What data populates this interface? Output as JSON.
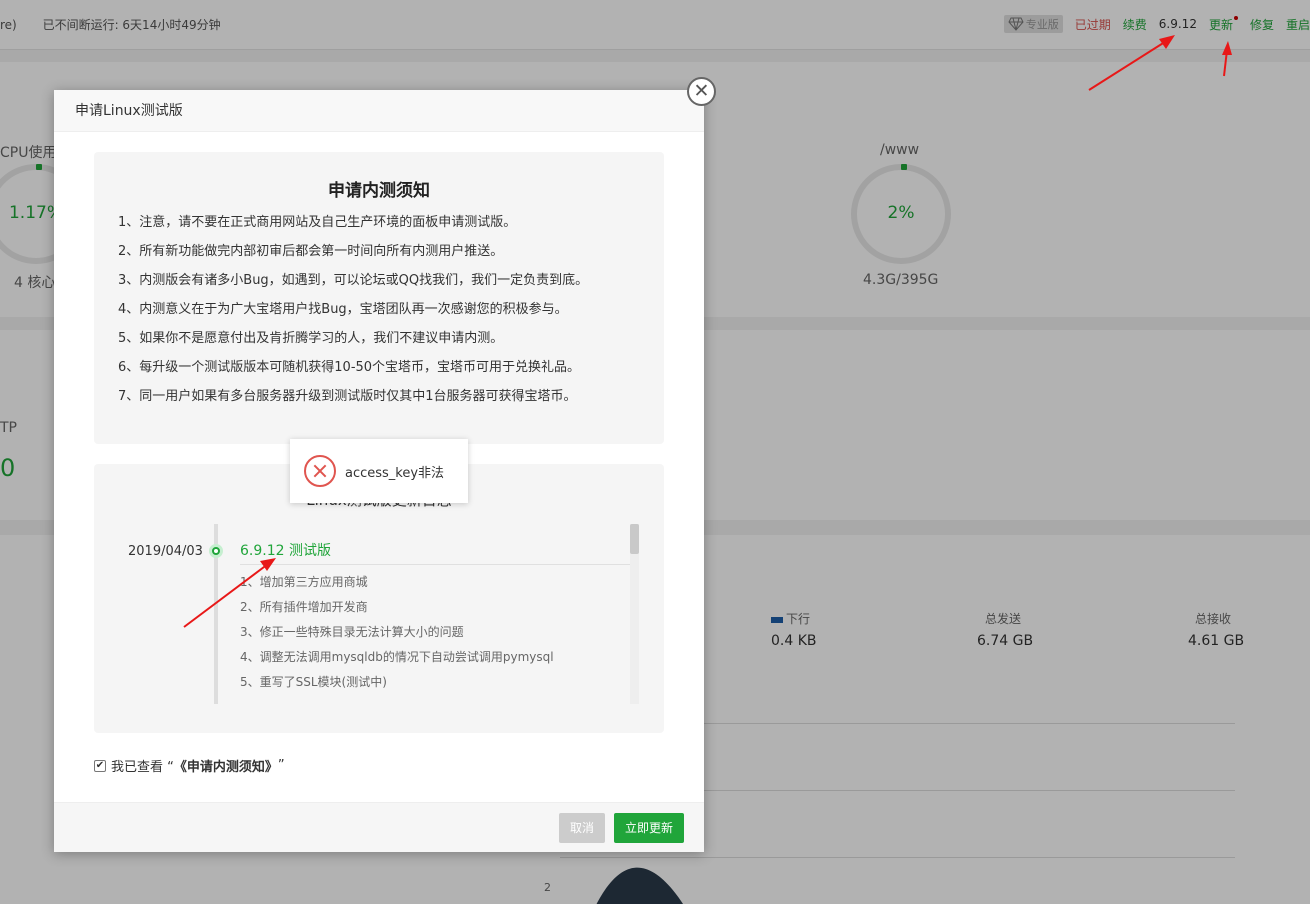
{
  "topbar": {
    "left_fragment": "re)",
    "uptime": "已不间断运行: 6天14小时49分钟",
    "pro_badge": "专业版",
    "expired": "已过期",
    "renew": "续费",
    "version": "6.9.12",
    "update": "更新",
    "repair": "修复",
    "restart": "重启"
  },
  "dashboard": {
    "cpu_label": "CPU使用",
    "cpu_value": "1.17%",
    "cpu_cores": "4 核心",
    "disk_label": "/www",
    "disk_value": "2%",
    "disk_size": "4.3G/395G",
    "ftp_label": "TP",
    "ftp_value": "0",
    "net_down_label": "下行",
    "net_down_value": "0.4 KB",
    "net_total_sent_label": "总发送",
    "net_total_sent_value": "6.74 GB",
    "net_total_recv_label": "总接收",
    "net_total_recv_value": "4.61 GB",
    "chart_tick": "2"
  },
  "modal": {
    "title": "申请Linux测试版",
    "close_glyph": "✕",
    "notice_title": "申请内测须知",
    "notice_items": [
      "1、注意，请不要在正式商用网站及自己生产环境的面板申请测试版。",
      "2、所有新功能做完内部初审后都会第一时间向所有内测用户推送。",
      "3、内测版会有诸多小Bug，如遇到，可以论坛或QQ找我们，我们一定负责到底。",
      "4、内测意义在于为广大宝塔用户找Bug，宝塔团队再一次感谢您的积极参与。",
      "5、如果你不是愿意付出及肯折腾学习的人，我们不建议申请内测。",
      "6、每升级一个测试版版本可随机获得10-50个宝塔币，宝塔币可用于兑换礼品。",
      "7、同一用户如果有多台服务器升级到测试版时仅其中1台服务器可获得宝塔币。"
    ],
    "log_title": "Linux测试版更新日志",
    "log_date": "2019/04/03",
    "log_version": "6.9.12 测试版",
    "log_items": [
      "1、增加第三方应用商城",
      "2、所有插件增加开发商",
      "3、修正一些特殊目录无法计算大小的问题",
      "4、调整无法调用mysqldb的情况下自动尝试调用pymysql",
      "5、重写了SSL模块(测试中)"
    ],
    "agree_prefix": "我已查看 “",
    "agree_link": "《申请内测须知》",
    "agree_suffix": "”",
    "checkbox_glyph": "✔",
    "cancel": "取消",
    "confirm": "立即更新"
  },
  "toast": {
    "message": "access_key非法"
  },
  "colors": {
    "accent": "#20a53a",
    "danger": "#e0554f",
    "arrow": "#e81818"
  }
}
